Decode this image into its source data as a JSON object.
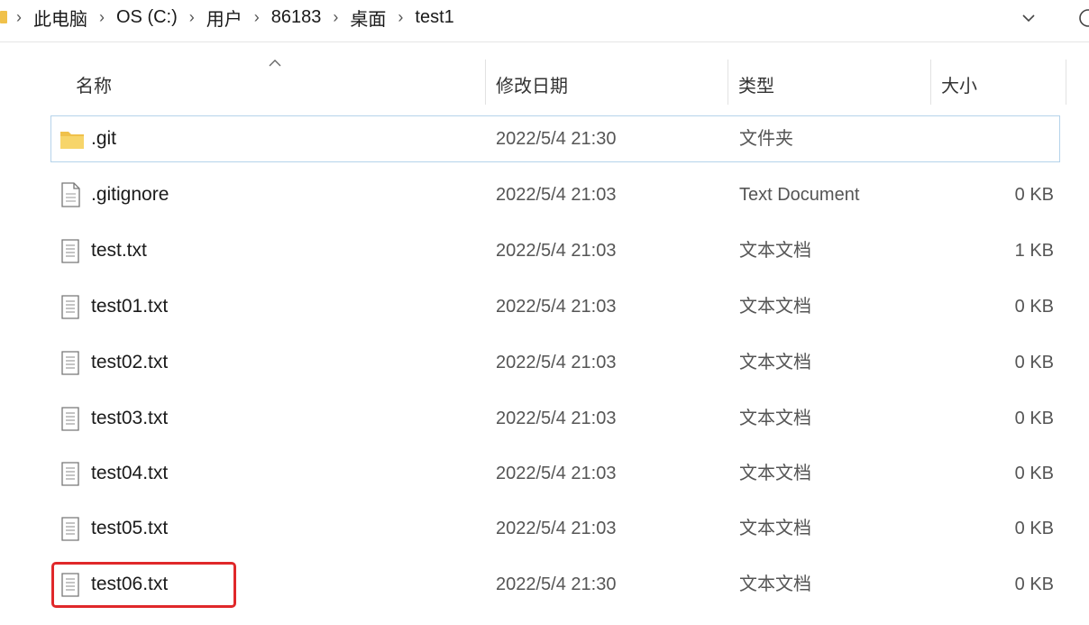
{
  "breadcrumb": {
    "items": [
      "此电脑",
      "OS (C:)",
      "用户",
      "86183",
      "桌面",
      "test1"
    ],
    "separator": "›"
  },
  "columns": {
    "name": "名称",
    "date": "修改日期",
    "type": "类型",
    "size": "大小"
  },
  "files": [
    {
      "name": ".git",
      "date": "2022/5/4 21:30",
      "type": "文件夹",
      "size": "",
      "icon": "folder-icon"
    },
    {
      "name": ".gitignore",
      "date": "2022/5/4 21:03",
      "type": "Text Document",
      "size": "0 KB",
      "icon": "document-icon"
    },
    {
      "name": "test.txt",
      "date": "2022/5/4 21:03",
      "type": "文本文档",
      "size": "1 KB",
      "icon": "text-file-icon"
    },
    {
      "name": "test01.txt",
      "date": "2022/5/4 21:03",
      "type": "文本文档",
      "size": "0 KB",
      "icon": "text-file-icon"
    },
    {
      "name": "test02.txt",
      "date": "2022/5/4 21:03",
      "type": "文本文档",
      "size": "0 KB",
      "icon": "text-file-icon"
    },
    {
      "name": "test03.txt",
      "date": "2022/5/4 21:03",
      "type": "文本文档",
      "size": "0 KB",
      "icon": "text-file-icon"
    },
    {
      "name": "test04.txt",
      "date": "2022/5/4 21:03",
      "type": "文本文档",
      "size": "0 KB",
      "icon": "text-file-icon"
    },
    {
      "name": "test05.txt",
      "date": "2022/5/4 21:03",
      "type": "文本文档",
      "size": "0 KB",
      "icon": "text-file-icon"
    },
    {
      "name": "test06.txt",
      "date": "2022/5/4 21:30",
      "type": "文本文档",
      "size": "0 KB",
      "icon": "text-file-icon"
    }
  ],
  "colors": {
    "highlight": "#e0282a",
    "focus_border": "#b5d3ea",
    "folder": "#f0c14b"
  }
}
